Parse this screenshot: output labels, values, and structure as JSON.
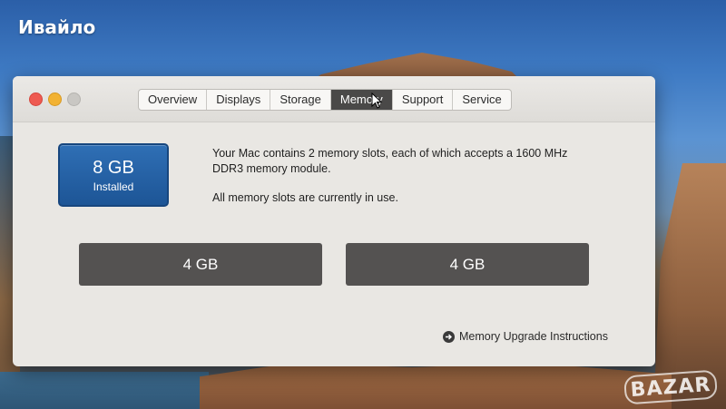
{
  "desktop": {
    "username": "Ивайло",
    "watermark": "BAZAR"
  },
  "window": {
    "tabs": [
      {
        "label": "Overview",
        "active": false
      },
      {
        "label": "Displays",
        "active": false
      },
      {
        "label": "Storage",
        "active": false
      },
      {
        "label": "Memory",
        "active": true
      },
      {
        "label": "Support",
        "active": false
      },
      {
        "label": "Service",
        "active": false
      }
    ],
    "installed": {
      "size": "8 GB",
      "label": "Installed"
    },
    "description": {
      "line1": "Your Mac contains 2 memory slots, each of which accepts a 1600 MHz DDR3 memory module.",
      "line2": "All memory slots are currently in use."
    },
    "slots": [
      {
        "label": "4 GB"
      },
      {
        "label": "4 GB"
      }
    ],
    "upgrade_link": "Memory Upgrade Instructions"
  },
  "colors": {
    "accent_blue": "#2f6fb5",
    "slot_gray": "#545251",
    "active_tab": "#4a4948",
    "close": "#ee5a51",
    "minimize": "#f2b233",
    "zoom_disabled": "#c9c7c3"
  },
  "icons": {
    "close": "close-button-icon",
    "minimize": "minimize-button-icon",
    "zoom": "zoom-button-icon",
    "link_arrow": "arrow-right-circle-icon",
    "cursor": "mouse-pointer-icon"
  }
}
